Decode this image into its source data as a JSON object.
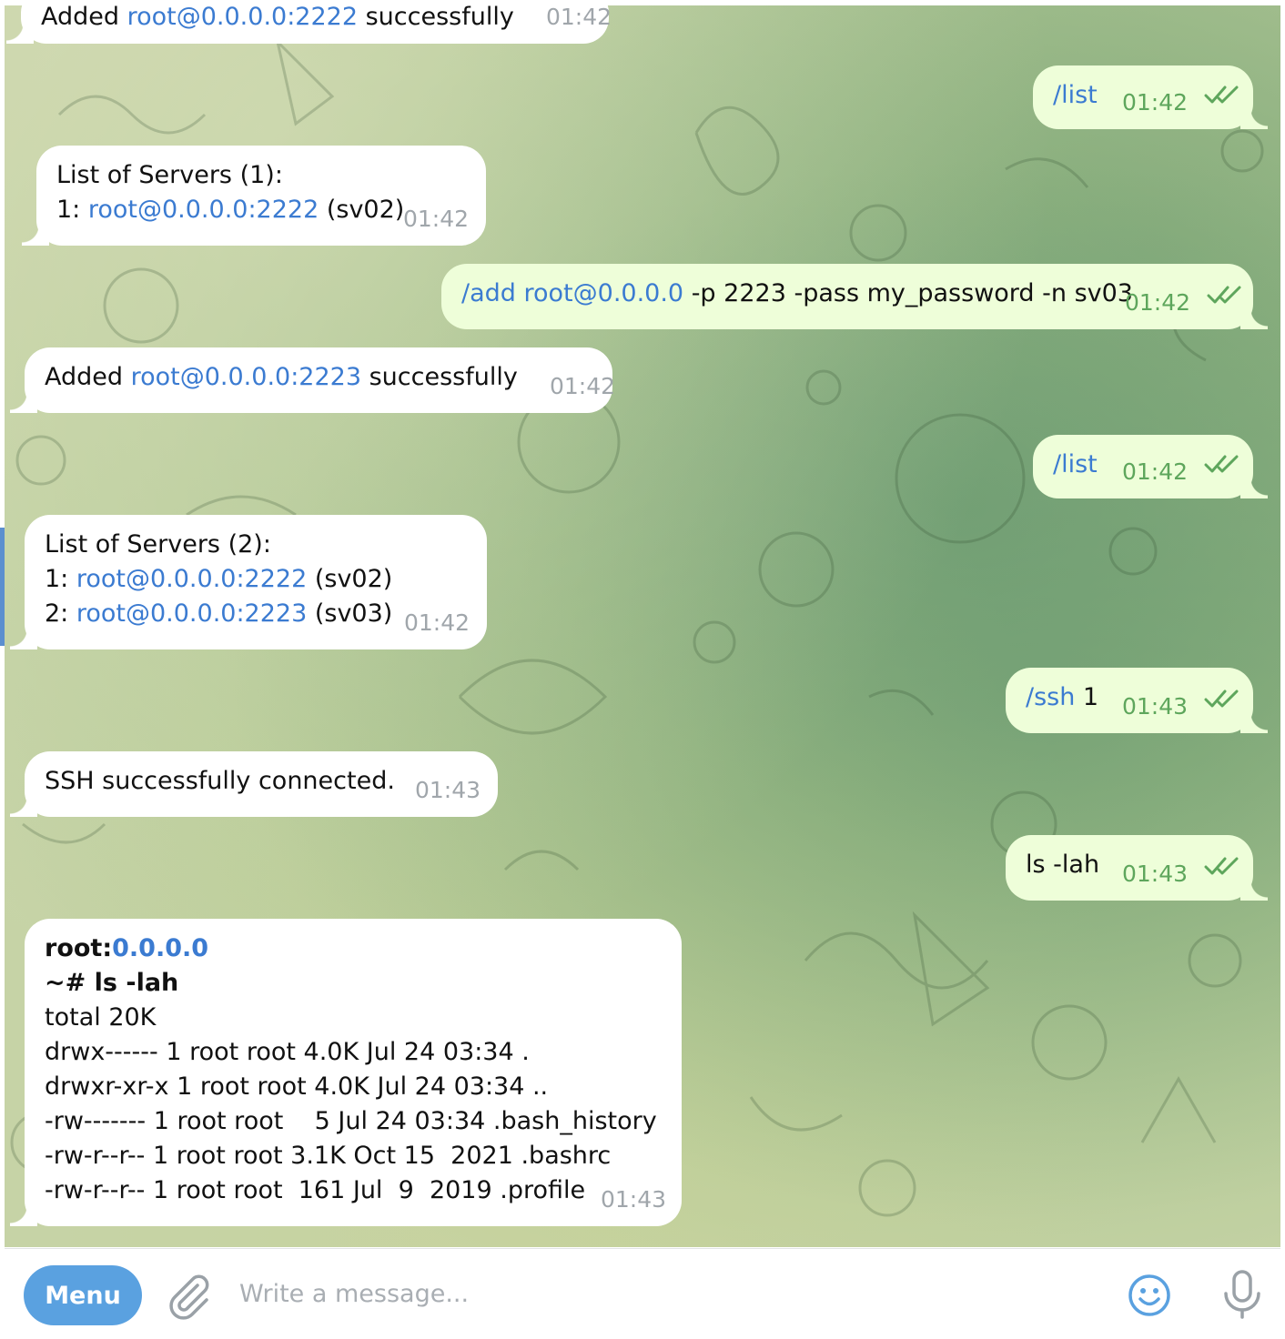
{
  "messages": [
    {
      "dir": "in",
      "parts": [
        {
          "t": "Added "
        },
        {
          "t": "root@0.0.0.0:2222",
          "link": true
        },
        {
          "t": " successfully"
        }
      ],
      "time": "01:42"
    },
    {
      "dir": "out",
      "parts": [
        {
          "t": "/list",
          "link": true
        }
      ],
      "time": "01:42"
    },
    {
      "dir": "in",
      "parts": [
        {
          "t": "List of Servers (1):\n1: "
        },
        {
          "t": "root@0.0.0.0:2222",
          "link": true
        },
        {
          "t": " (sv02)"
        }
      ],
      "time": "01:42"
    },
    {
      "dir": "out",
      "parts": [
        {
          "t": "/add",
          "link": true
        },
        {
          "t": " "
        },
        {
          "t": "root@0.0.0.0",
          "link": true
        },
        {
          "t": " -p 2223 -pass my_password -n sv03"
        }
      ],
      "time": "01:42"
    },
    {
      "dir": "in",
      "parts": [
        {
          "t": "Added "
        },
        {
          "t": "root@0.0.0.0:2223",
          "link": true
        },
        {
          "t": " successfully"
        }
      ],
      "time": "01:42"
    },
    {
      "dir": "out",
      "parts": [
        {
          "t": "/list",
          "link": true
        }
      ],
      "time": "01:42"
    },
    {
      "dir": "in",
      "parts": [
        {
          "t": "List of Servers (2):\n1: "
        },
        {
          "t": "root@0.0.0.0:2222",
          "link": true
        },
        {
          "t": " (sv02)\n2: "
        },
        {
          "t": "root@0.0.0.0:2223",
          "link": true
        },
        {
          "t": " (sv03)"
        }
      ],
      "time": "01:42"
    },
    {
      "dir": "out",
      "parts": [
        {
          "t": "/ssh",
          "link": true
        },
        {
          "t": " 1"
        }
      ],
      "time": "01:43"
    },
    {
      "dir": "in",
      "parts": [
        {
          "t": "SSH successfully connected."
        }
      ],
      "time": "01:43"
    },
    {
      "dir": "out",
      "parts": [
        {
          "t": "ls -lah"
        }
      ],
      "time": "01:43"
    },
    {
      "dir": "in",
      "parts": [
        {
          "t": "root:",
          "bold": true
        },
        {
          "t": "0.0.0.0",
          "bold": true,
          "link": true
        },
        {
          "t": "\n~# ls -lah",
          "bold": true
        },
        {
          "t": "\ntotal 20K\ndrwx------ 1 root root 4.0K Jul 24 03:34 .\ndrwxr-xr-x 1 root root 4.0K Jul 24 03:34 ..\n-rw------- 1 root root    5 Jul 24 03:34 .bash_history\n-rw-r--r-- 1 root root 3.1K Oct 15  2021 .bashrc\n-rw-r--r-- 1 root root  161 Jul  9  2019 .profile"
        }
      ],
      "time": "01:43"
    }
  ],
  "composer": {
    "menu_label": "Menu",
    "placeholder": "Write a message..."
  },
  "icons": {
    "attach": "paperclip-icon",
    "emoji": "smiley-icon",
    "mic": "microphone-icon",
    "read": "double-check-icon"
  },
  "colors": {
    "link": "#3b7bd1",
    "outgoing_bubble": "#eefed9",
    "incoming_bubble": "#ffffff",
    "menu_button": "#5aa1e0",
    "time_out": "#5ea65c",
    "time_in": "#a0a6ab"
  }
}
